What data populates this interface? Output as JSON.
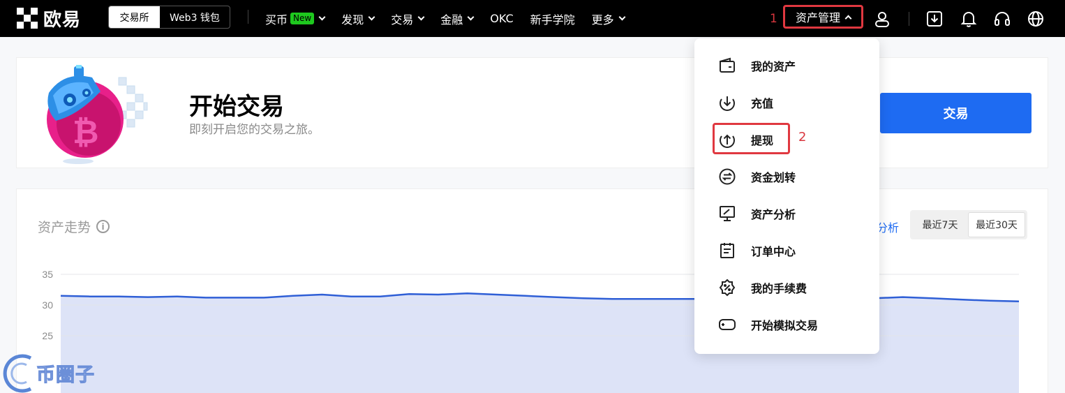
{
  "nav": {
    "logo_text": "欧易",
    "segment": {
      "active": "交易所",
      "other": "Web3 钱包"
    },
    "menu": [
      {
        "label": "买币",
        "badge": "New",
        "has_chevron": true
      },
      {
        "label": "发现",
        "has_chevron": true
      },
      {
        "label": "交易",
        "has_chevron": true
      },
      {
        "label": "金融",
        "has_chevron": true
      },
      {
        "label": "OKC",
        "has_chevron": false
      },
      {
        "label": "新手学院",
        "has_chevron": false
      },
      {
        "label": "更多",
        "has_chevron": true
      }
    ],
    "step1_marker": "1",
    "asset_management": "资产管理",
    "icons": [
      "user-icon",
      "download-icon",
      "bell-icon",
      "headset-icon",
      "globe-icon"
    ]
  },
  "hero": {
    "title": "开始交易",
    "subtitle": "即刻开启您的交易之旅。",
    "button": "交易"
  },
  "asset_chart": {
    "title": "资产走势",
    "info_symbol": "i",
    "analysis_link_partial": "分析",
    "range_options": [
      "最近7天",
      "最近30天"
    ],
    "active_range": "最近30天"
  },
  "dropdown": {
    "items": [
      {
        "label": "我的资产",
        "icon": "wallet-icon"
      },
      {
        "label": "充值",
        "icon": "deposit-icon"
      },
      {
        "label": "提现",
        "icon": "withdraw-icon"
      },
      {
        "label": "资金划转",
        "icon": "transfer-icon"
      },
      {
        "label": "资产分析",
        "icon": "analysis-icon"
      },
      {
        "label": "订单中心",
        "icon": "order-icon"
      },
      {
        "label": "我的手续费",
        "icon": "fee-icon"
      },
      {
        "label": "开始模拟交易",
        "icon": "demo-trading-icon"
      }
    ],
    "highlighted": "提现",
    "step2_marker": "2"
  },
  "chart_data": {
    "type": "area",
    "title": "资产走势",
    "xlabel": "",
    "ylabel": "",
    "yticks": [
      25,
      30,
      35
    ],
    "ylim": [
      20,
      35
    ],
    "series": [
      {
        "values": [
          31.5,
          31.4,
          31.4,
          31.3,
          31.4,
          31.2,
          31.2,
          31.2,
          31.5,
          31.7,
          31.4,
          31.4,
          31.8,
          31.7,
          31.9,
          31.7,
          31.5,
          31.3,
          31.1,
          31.0,
          31.0,
          31.0,
          31.0,
          30.9,
          31.0,
          31.0,
          31.1,
          31.0,
          31.1,
          31.3,
          31.1,
          30.9,
          30.7,
          30.6
        ]
      }
    ],
    "grid": true,
    "colors": {
      "line": "#2f5fd6",
      "fill": "#dde3f7"
    }
  },
  "watermark": {
    "text": "币圈子"
  },
  "colors": {
    "accent": "#1e6bf2",
    "highlight": "#e03840",
    "nav_bg": "#000000"
  }
}
